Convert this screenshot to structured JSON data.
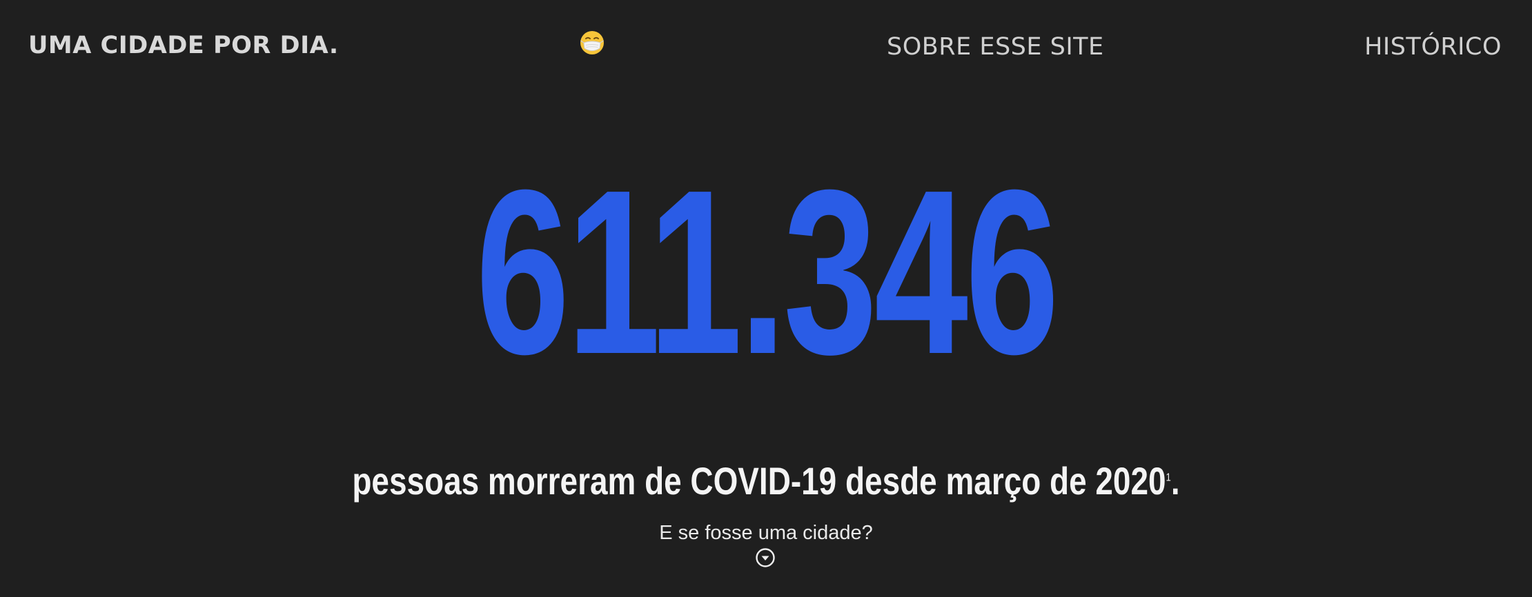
{
  "nav": {
    "brand": "UMA CIDADE POR DIA.",
    "emoji": "😷",
    "about_label": "SOBRE ESSE SITE",
    "history_label": "HISTÓRICO"
  },
  "hero": {
    "count": "611.346",
    "headline_text": "pessoas morreram de COVID-19 desde março de 2020",
    "footnote_marker": "1",
    "headline_end": ".",
    "question": "E se fosse uma cidade?"
  },
  "colors": {
    "background": "#1f1f1f",
    "accent": "#2a5ce6",
    "text": "#f4f4f4"
  },
  "icons": {
    "scroll": "chevron-down-circle-icon",
    "emoji": "face-with-medical-mask"
  }
}
